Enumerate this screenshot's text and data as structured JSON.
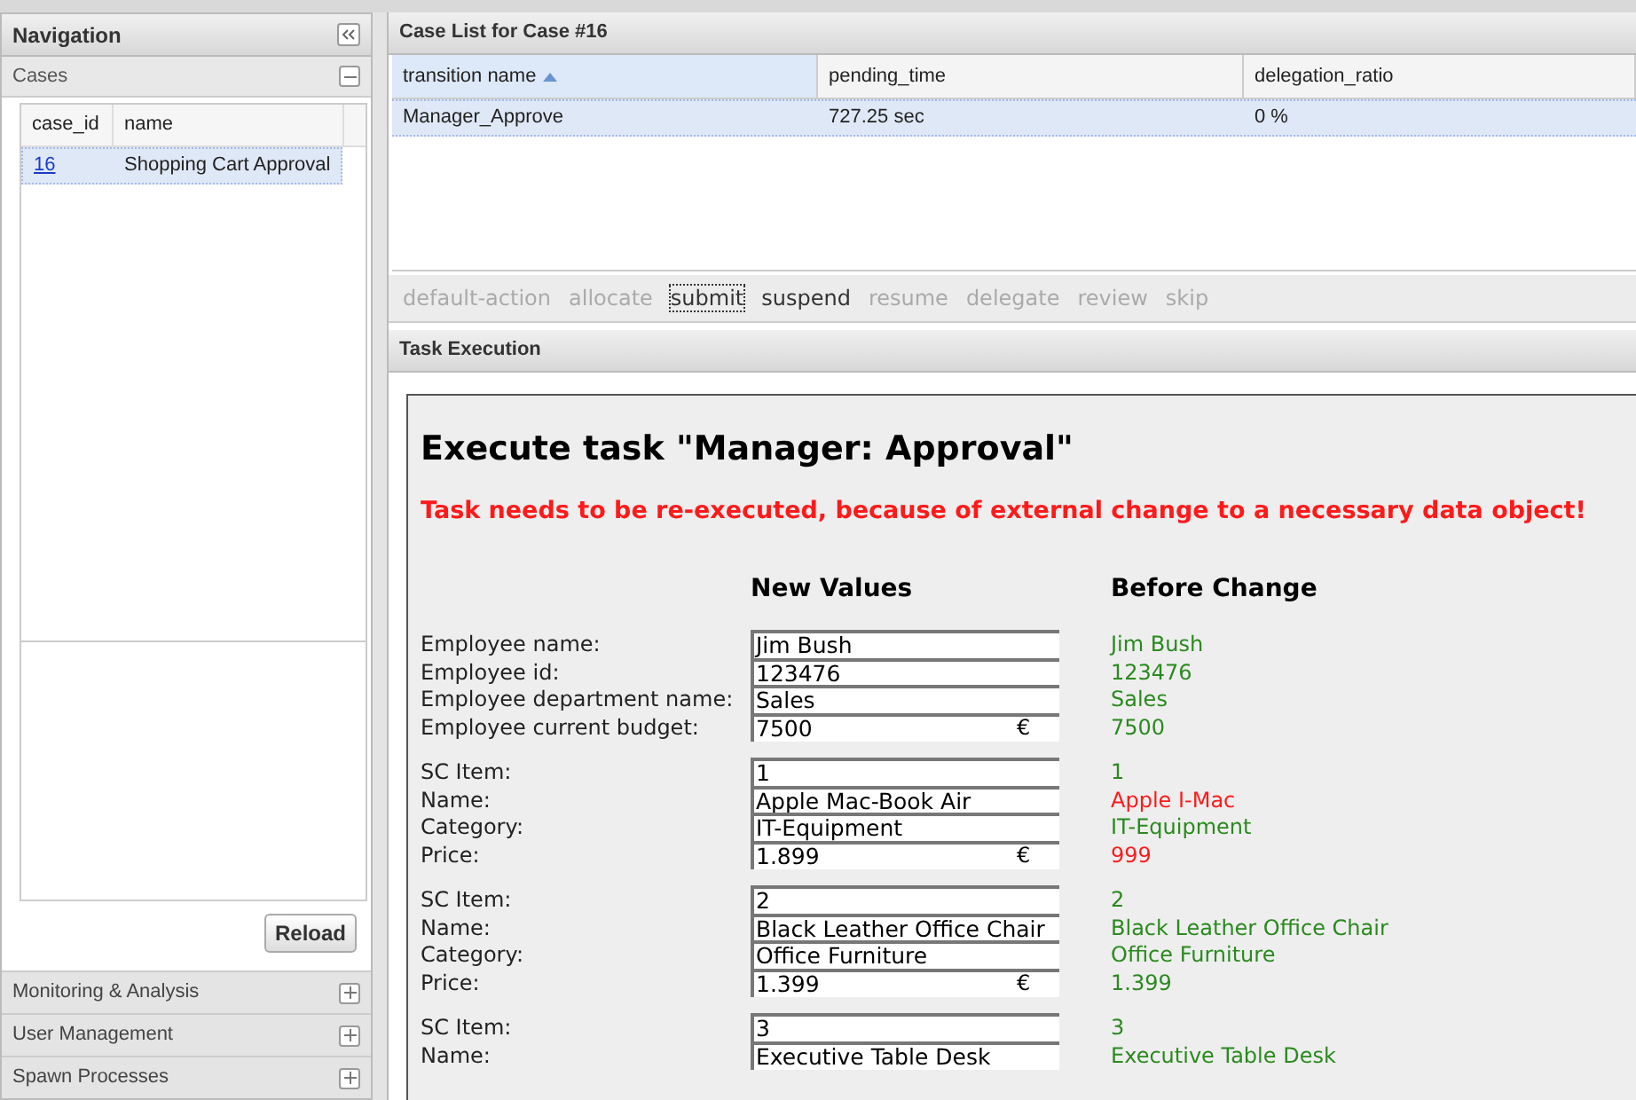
{
  "navigation": {
    "title": "Navigation",
    "cases_panel": {
      "title": "Cases",
      "expanded": true,
      "columns": [
        "case_id",
        "name"
      ],
      "rows": [
        {
          "case_id": "16",
          "name": "Shopping Cart Approval",
          "selected": true
        }
      ],
      "reload_button": "Reload"
    },
    "sections": [
      {
        "title": "Monitoring & Analysis",
        "expanded": false
      },
      {
        "title": "User Management",
        "expanded": false
      },
      {
        "title": "Spawn Processes",
        "expanded": false
      }
    ]
  },
  "case_list": {
    "title": "Case List for Case #16",
    "columns": [
      {
        "label": "transition name",
        "sorted": true
      },
      {
        "label": "pending_time",
        "sorted": false
      },
      {
        "label": "delegation_ratio",
        "sorted": false
      }
    ],
    "rows": [
      {
        "cells": [
          "Manager_Approve",
          "727.25 sec",
          "0 %"
        ],
        "selected": true
      }
    ]
  },
  "actions": [
    {
      "label": "default-action",
      "disabled": true,
      "focused": false
    },
    {
      "label": "allocate",
      "disabled": true,
      "focused": false
    },
    {
      "label": "submit",
      "disabled": false,
      "focused": true
    },
    {
      "label": "suspend",
      "disabled": false,
      "focused": false
    },
    {
      "label": "resume",
      "disabled": true,
      "focused": false
    },
    {
      "label": "delegate",
      "disabled": true,
      "focused": false
    },
    {
      "label": "review",
      "disabled": true,
      "focused": false
    },
    {
      "label": "skip",
      "disabled": true,
      "focused": false
    }
  ],
  "task_execution": {
    "title": "Task Execution",
    "heading": "Execute task \"Manager: Approval\"",
    "warning": "Task needs to be re-executed, because of external change to a necessary data object!",
    "new_values_heading": "New Values",
    "before_change_heading": "Before Change",
    "groups": [
      {
        "fields": [
          {
            "label": "Employee name:",
            "value": "Jim Bush",
            "before": "Jim Bush",
            "changed": false
          },
          {
            "label": "Employee id:",
            "value": "123476",
            "before": "123476",
            "changed": false
          },
          {
            "label": "Employee department name:",
            "value": "Sales",
            "before": "Sales",
            "changed": false
          },
          {
            "label": "Employee current budget:",
            "value": "7500",
            "suffix": "€",
            "before": "7500",
            "changed": false
          }
        ]
      },
      {
        "fields": [
          {
            "label": "SC Item:",
            "value": "1",
            "before": "1",
            "changed": false
          },
          {
            "label": "Name:",
            "value": "Apple Mac-Book Air",
            "before": "Apple I-Mac",
            "changed": true
          },
          {
            "label": "Category:",
            "value": "IT-Equipment",
            "before": "IT-Equipment",
            "changed": false
          },
          {
            "label": "Price:",
            "value": "1.899",
            "suffix": "€",
            "before": "999",
            "changed": true
          }
        ]
      },
      {
        "fields": [
          {
            "label": "SC Item:",
            "value": "2",
            "before": "2",
            "changed": false
          },
          {
            "label": "Name:",
            "value": "Black Leather Office Chair",
            "before": "Black Leather Office Chair",
            "changed": false
          },
          {
            "label": "Category:",
            "value": "Office Furniture",
            "before": "Office Furniture",
            "changed": false
          },
          {
            "label": "Price:",
            "value": "1.399",
            "suffix": "€",
            "before": "1.399",
            "changed": false
          }
        ]
      },
      {
        "fields": [
          {
            "label": "SC Item:",
            "value": "3",
            "before": "3",
            "changed": false
          },
          {
            "label": "Name:",
            "value": "Executive Table Desk",
            "before": "Executive Table Desk",
            "changed": false
          }
        ]
      }
    ]
  }
}
